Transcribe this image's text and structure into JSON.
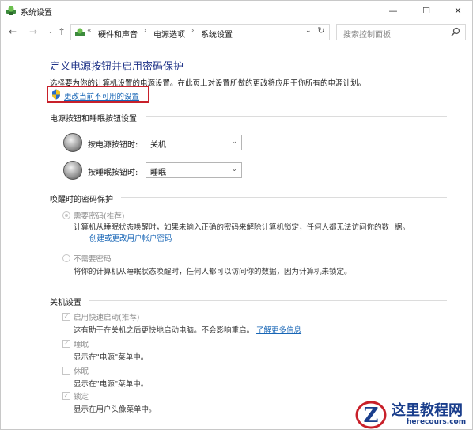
{
  "window": {
    "title": "系统设置",
    "minimize_glyph": "—",
    "maximize_glyph": "☐",
    "close_glyph": "✕"
  },
  "nav": {
    "back_glyph": "←",
    "forward_glyph": "→",
    "recent_glyph": "⌄",
    "up_glyph": "↑",
    "overflow_glyph": "«",
    "breadcrumbs": [
      "硬件和声音",
      "电源选项",
      "系统设置"
    ],
    "sep_glyph": "›",
    "dropdown_glyph": "⌄",
    "refresh_glyph": "↻",
    "search_placeholder": "搜索控制面板"
  },
  "page": {
    "title": "定义电源按钮并启用密码保护",
    "description": "选择要为你的计算机设置的电源设置。在此页上对设置所做的更改将应用于你所有的电源计划。",
    "uac_link": "更改当前不可用的设置"
  },
  "power_buttons": {
    "group_title": "电源按钮和睡眠按钮设置",
    "rows": [
      {
        "label": "按电源按钮时:",
        "value": "关机"
      },
      {
        "label": "按睡眠按钮时:",
        "value": "睡眠"
      }
    ],
    "chevron_glyph": "⌄"
  },
  "wake_password": {
    "group_title": "唤醒时的密码保护",
    "options": [
      {
        "label": "需要密码(推荐)",
        "checked": true,
        "description": "计算机从睡眠状态唤醒时，如果未输入正确的密码来解除计算机锁定，任何人都无法访问你的数",
        "description2": "据。",
        "link": "创建或更改用户帐户密码"
      },
      {
        "label": "不需要密码",
        "checked": false,
        "description": "将你的计算机从睡眠状态唤醒时，任何人都可以访问你的数据，因为计算机未锁定。"
      }
    ]
  },
  "shutdown": {
    "group_title": "关机设置",
    "check_glyph": "✓",
    "items": [
      {
        "label": "启用快速启动(推荐)",
        "checked": true,
        "description": "这有助于在关机之后更快地启动电脑。不会影响重启。",
        "link": "了解更多信息"
      },
      {
        "label": "睡眠",
        "checked": true,
        "description": "显示在\"电源\"菜单中。"
      },
      {
        "label": "休眠",
        "checked": false,
        "description": "显示在\"电源\"菜单中。"
      },
      {
        "label": "锁定",
        "checked": true,
        "description": "显示在用户头像菜单中。"
      }
    ]
  },
  "watermark": {
    "text": "这里教程网",
    "url": "herecours.com"
  },
  "colors": {
    "title_blue": "#1e3287",
    "link_blue": "#1866b6",
    "highlight_red": "#c8202a",
    "watermark_blue": "#1a3e8c"
  }
}
